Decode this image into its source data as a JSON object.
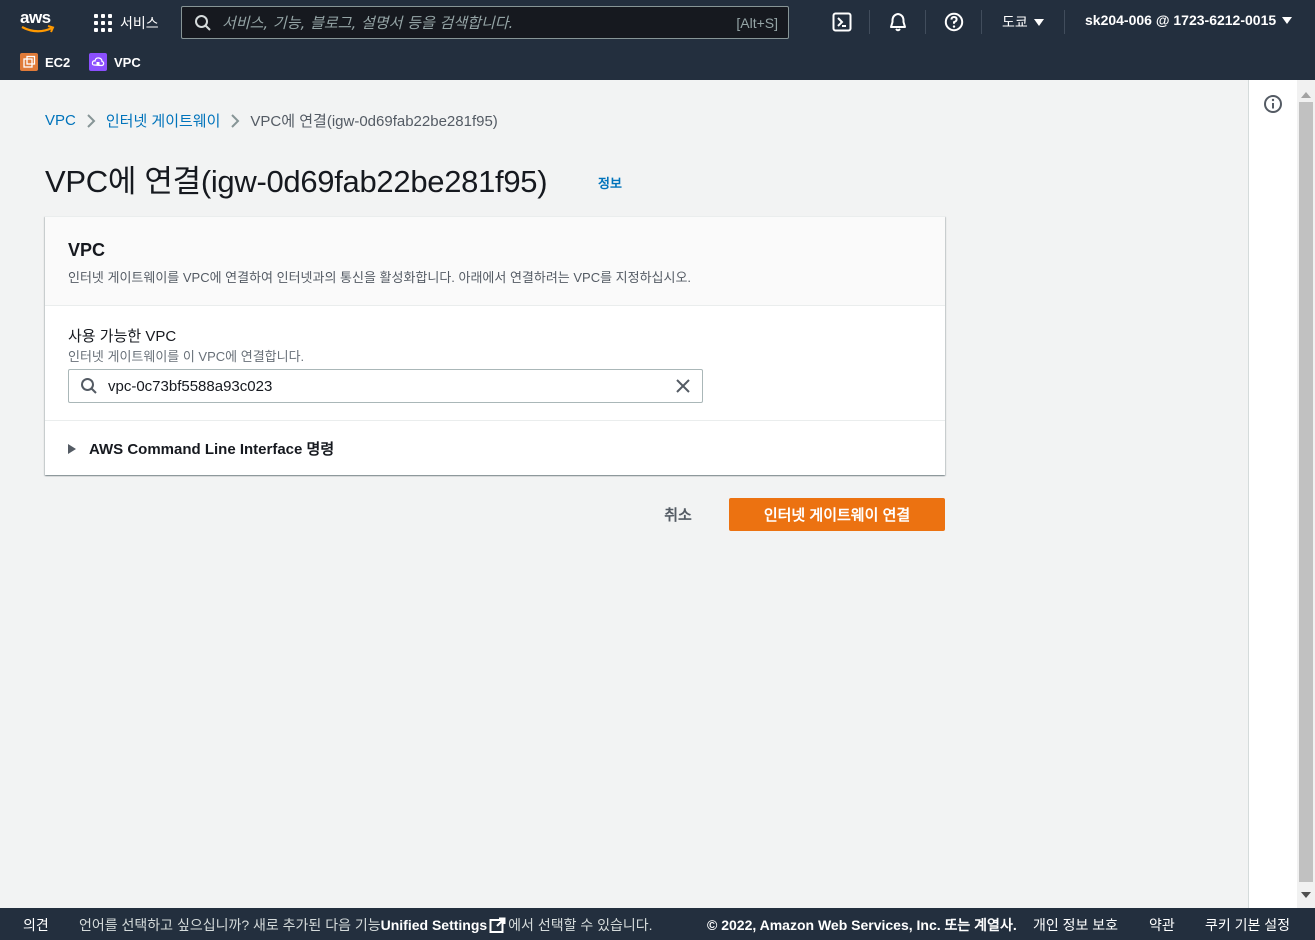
{
  "topnav": {
    "logo_text": "aws",
    "services_label": "서비스",
    "search_placeholder": "서비스, 기능, 블로그, 설명서 등을 검색합니다.",
    "search_shortcut": "[Alt+S]",
    "region": "도쿄",
    "account": "sk204-006 @ 1723-6212-0015",
    "favorites": [
      {
        "label": "EC2",
        "color": "#e07b39"
      },
      {
        "label": "VPC",
        "color": "#8c4fff"
      }
    ]
  },
  "breadcrumb": {
    "items": [
      "VPC",
      "인터넷 게이트웨이"
    ],
    "current": "VPC에 연결(igw-0d69fab22be281f95)"
  },
  "page": {
    "title": "VPC에 연결(igw-0d69fab22be281f95)",
    "info_link": "정보"
  },
  "panel": {
    "header_title": "VPC",
    "header_desc": "인터넷 게이트웨이를 VPC에 연결하여 인터넷과의 통신을 활성화합니다. 아래에서 연결하려는 VPC를 지정하십시오.",
    "field_label": "사용 가능한 VPC",
    "field_desc": "인터넷 게이트웨이를 이 VPC에 연결합니다.",
    "field_value": "vpc-0c73bf5588a93c023",
    "cli_label": "AWS Command Line Interface 명령"
  },
  "actions": {
    "cancel": "취소",
    "submit": "인터넷 게이트웨이 연결"
  },
  "footer": {
    "feedback": "의견",
    "lang_prefix": "언어를 선택하고 싶으십니까? 새로 추가된 다음 기능",
    "lang_link": "Unified Settings",
    "lang_suffix": "에서 선택할 수 있습니다.",
    "copyright": "© 2022, Amazon Web Services, Inc. 또는 계열사.",
    "privacy": "개인 정보 보호",
    "terms": "약관",
    "cookies": "쿠키 기본 설정"
  },
  "colors": {
    "nav_bg": "#232f3e",
    "primary": "#ec7211",
    "link": "#0073bb"
  }
}
